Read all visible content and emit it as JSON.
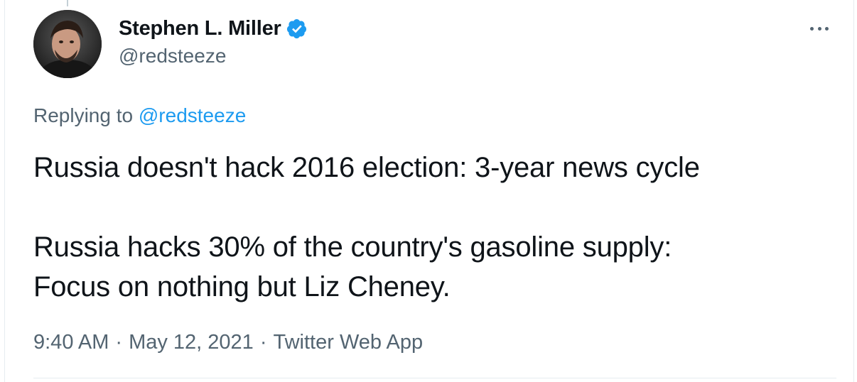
{
  "author": {
    "display_name": "Stephen L. Miller",
    "handle": "@redsteeze",
    "verified": true,
    "avatar_icon": "user-avatar-icon",
    "verified_icon": "verified-badge-icon"
  },
  "more_icon": "more-options-icon",
  "replying": {
    "prefix": "Replying to",
    "mention": "@redsteeze"
  },
  "tweet": {
    "line1": "Russia doesn't hack 2016 election: 3-year news cycle",
    "line2": "Russia hacks 30% of the country's gasoline supply:",
    "line3": "Focus on nothing but Liz Cheney."
  },
  "meta": {
    "time": "9:40 AM",
    "separator": "·",
    "date": "May 12, 2021",
    "source": "Twitter Web App"
  },
  "colors": {
    "text": "#0f1419",
    "secondary": "#536471",
    "link": "#1d9bf0",
    "verified": "#1d9bf0"
  }
}
